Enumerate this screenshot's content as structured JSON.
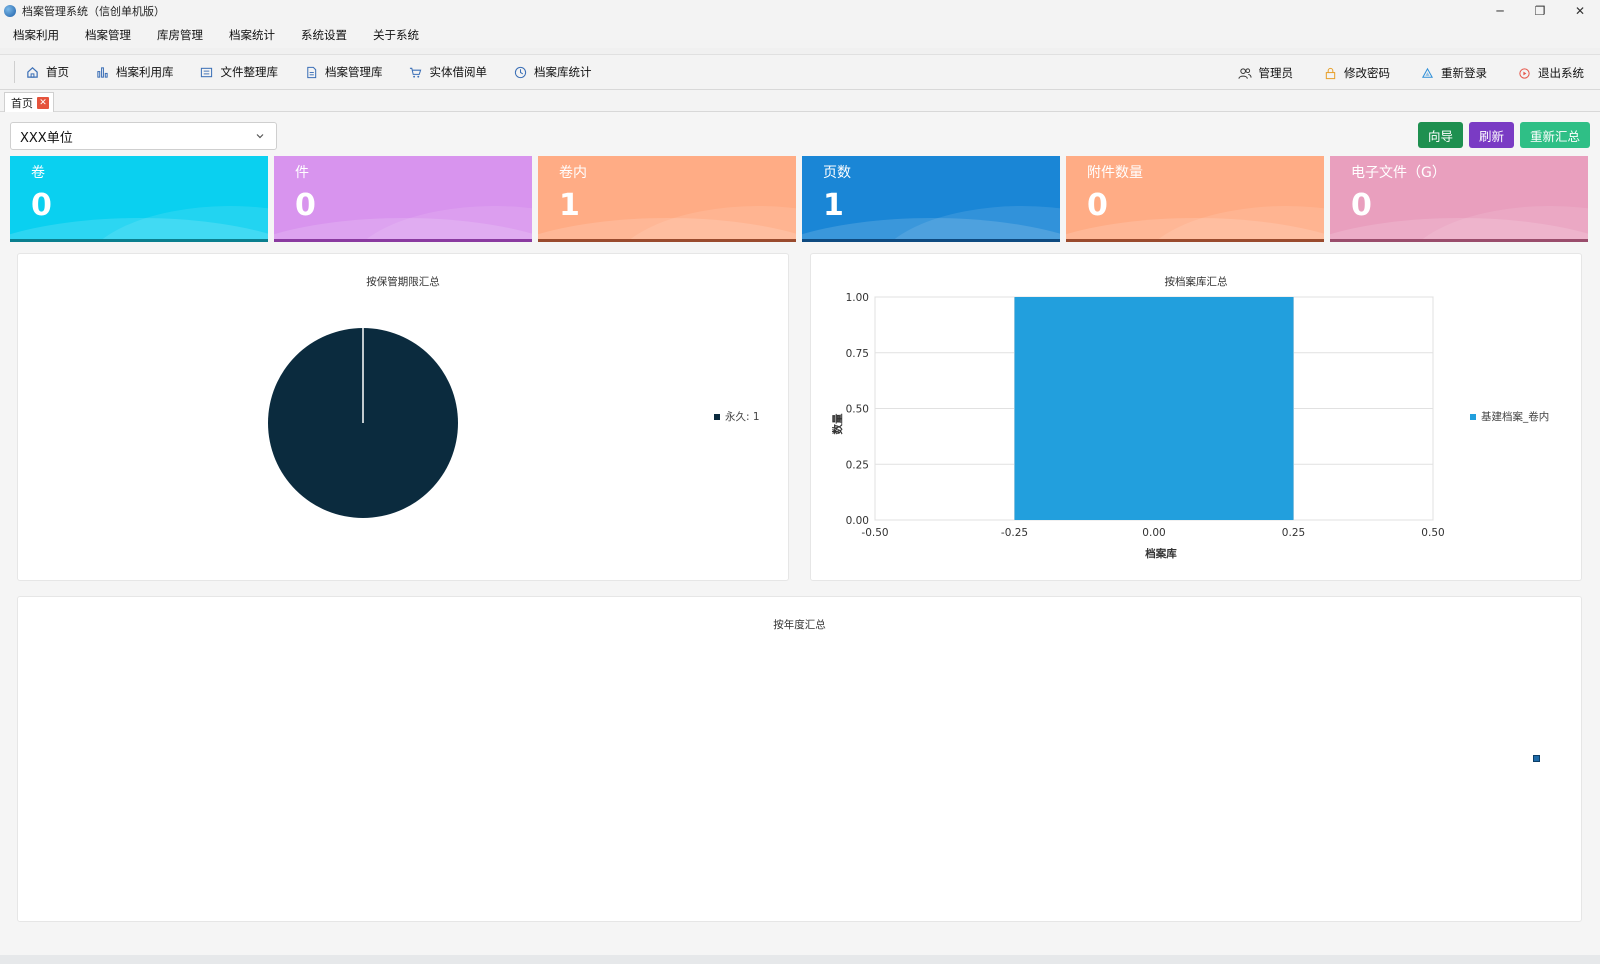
{
  "window": {
    "title": "档案管理系统（信创单机版）",
    "controls": {
      "minimize": "─",
      "maximize": "❐",
      "close": "✕"
    }
  },
  "menubar": {
    "items": [
      "档案利用",
      "档案管理",
      "库房管理",
      "档案统计",
      "系统设置",
      "关于系统"
    ]
  },
  "toolbar": {
    "left": [
      {
        "label": "首页",
        "icon": "home-icon"
      },
      {
        "label": "档案利用库",
        "icon": "bar-chart-icon"
      },
      {
        "label": "文件整理库",
        "icon": "document-list-icon"
      },
      {
        "label": "档案管理库",
        "icon": "file-icon"
      },
      {
        "label": "实体借阅单",
        "icon": "cart-icon"
      },
      {
        "label": "档案库统计",
        "icon": "clock-icon"
      }
    ],
    "right": [
      {
        "label": "管理员",
        "icon": "users-icon"
      },
      {
        "label": "修改密码",
        "icon": "lock-icon"
      },
      {
        "label": "重新登录",
        "icon": "refresh-login-icon"
      },
      {
        "label": "退出系统",
        "icon": "power-icon"
      }
    ]
  },
  "doc_tabs": [
    {
      "label": "首页",
      "close": "✕"
    }
  ],
  "unit_select": {
    "value": "XXX单位"
  },
  "actions": [
    {
      "label": "向导",
      "color": "#1e9050"
    },
    {
      "label": "刷新",
      "color": "#7a3bc4"
    },
    {
      "label": "重新汇总",
      "color": "#2fbf86"
    }
  ],
  "stats": [
    {
      "label": "卷",
      "value": "0",
      "color": "#0ad0f0",
      "line": "#0a7f8f"
    },
    {
      "label": "件",
      "value": "0",
      "color": "#d894ee",
      "line": "#8a3aa0"
    },
    {
      "label": "卷内",
      "value": "1",
      "color": "#ffac85",
      "line": "#9a4b2e"
    },
    {
      "label": "页数",
      "value": "1",
      "color": "#1a86d6",
      "line": "#0e4a80"
    },
    {
      "label": "附件数量",
      "value": "0",
      "color": "#ffac85",
      "line": "#9a4b2e"
    },
    {
      "label": "电子文件（G）",
      "value": "0",
      "color": "#e99fbe",
      "line": "#9a4d6c"
    }
  ],
  "panels": {
    "pie_title": "按保管期限汇总",
    "bar_title": "按档案库汇总",
    "year_title": "按年度汇总"
  },
  "chart_data": [
    {
      "type": "pie",
      "title": "按保管期限汇总",
      "slices": [
        {
          "label": "永久",
          "value": 1,
          "legend": "永久: 1",
          "color": "#0b2b3e"
        }
      ],
      "legend": "right"
    },
    {
      "type": "bar",
      "title": "按档案库汇总",
      "xlabel": "档案库",
      "ylabel": "数量",
      "x": [
        0.0
      ],
      "series": [
        {
          "name": "基建档案_卷内",
          "values": [
            1
          ],
          "color": "#229fdd"
        }
      ],
      "bar_x_range": [
        -0.25,
        0.25
      ],
      "xlim": [
        -0.5,
        0.5
      ],
      "ylim": [
        0,
        1
      ],
      "xticks": [
        "-0.50",
        "-0.25",
        "0.00",
        "0.25",
        "0.50"
      ],
      "yticks": [
        "0.00",
        "0.25",
        "0.50",
        "0.75",
        "1.00"
      ],
      "grid": true,
      "legend": "right"
    },
    {
      "type": "bar",
      "title": "按年度汇总",
      "series": [
        {
          "color": "#1e6aa8"
        }
      ],
      "legend": "right"
    }
  ]
}
